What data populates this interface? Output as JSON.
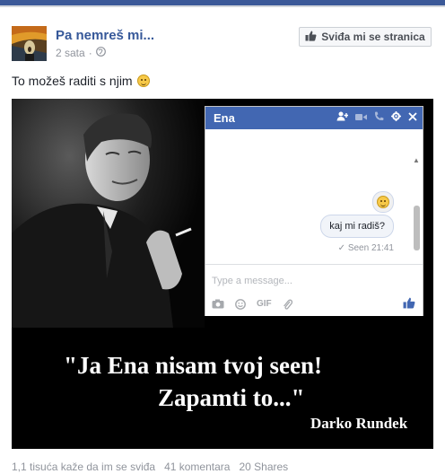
{
  "post": {
    "page_name": "Pa nemreš mi...",
    "time": "2 sata",
    "like_page_label": "Sviđa mi se stranica",
    "text": "To možeš raditi s njim"
  },
  "image": {
    "chat": {
      "name": "Ena",
      "message": "kaj mi radiš?",
      "seen": "Seen 21:41",
      "placeholder": "Type a message...",
      "tool_gif": "GIF"
    },
    "quote_line1": "\"Ja Ena nisam tvoj seen!",
    "quote_line2": "Zapamti to...\"",
    "author": "Darko Rundek"
  },
  "stats": {
    "likes": "1,1 tisuća kaže da im se sviđa",
    "comments": "41 komentara",
    "shares": "20 Shares"
  }
}
